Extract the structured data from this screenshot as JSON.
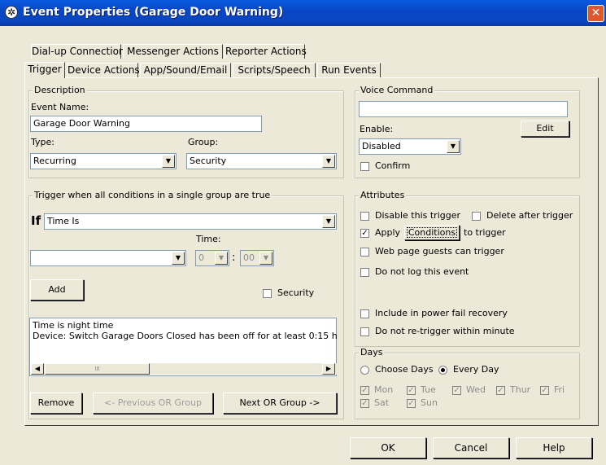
{
  "window": {
    "title": "Event Properties (Garage Door Warning)",
    "close_glyph": "✕"
  },
  "tabs_row1": [
    "Dial-up Connection",
    "Messenger Actions",
    "Reporter Actions"
  ],
  "tabs_row2": [
    "Trigger",
    "Device Actions",
    "App/Sound/Email",
    "Scripts/Speech",
    "Run Events"
  ],
  "description": {
    "group_label": "Description",
    "event_name_label": "Event Name:",
    "event_name_value": "Garage Door Warning",
    "type_label": "Type:",
    "type_value": "Recurring",
    "group_field_label": "Group:",
    "group_value": "Security"
  },
  "voice": {
    "group_label": "Voice Command",
    "command_value": "",
    "enable_label": "Enable:",
    "enable_value": "Disabled",
    "edit_label": "Edit",
    "confirm_label": "Confirm"
  },
  "trigger": {
    "group_label": "Trigger when all conditions in a single group are true",
    "if_label": "If",
    "condition_value": "Time Is",
    "secondary_value": "",
    "time_label": "Time:",
    "hour_value": "0",
    "time_sep": ":",
    "minute_value": "00",
    "add_label": "Add",
    "security_label": "Security",
    "conditions": [
      "Time is night time",
      "Device: Switch Garage Doors Closed has been off for at least 0:15 h"
    ],
    "scroll_thumb": "III",
    "remove_label": "Remove",
    "prev_label": "<- Previous OR Group",
    "next_label": "Next OR Group ->"
  },
  "attributes": {
    "group_label": "Attributes",
    "disable_label": "Disable this trigger",
    "delete_label": "Delete after trigger",
    "apply_label": "Apply",
    "conditions_button": "Conditions",
    "to_trigger_label": "to trigger",
    "web_label": "Web page guests can trigger",
    "nolog_label": "Do not log this event",
    "power_label": "Include in power fail recovery",
    "retrigger_label": "Do not re-trigger within minute"
  },
  "days": {
    "group_label": "Days",
    "choose_label": "Choose Days",
    "every_label": "Every Day",
    "items": [
      "Mon",
      "Tue",
      "Wed",
      "Thur",
      "Fri",
      "Sat",
      "Sun"
    ]
  },
  "footer": {
    "ok": "OK",
    "cancel": "Cancel",
    "help": "Help"
  },
  "glyphs": {
    "check": "✓",
    "down": "▼",
    "left": "◀",
    "right": "▶"
  }
}
